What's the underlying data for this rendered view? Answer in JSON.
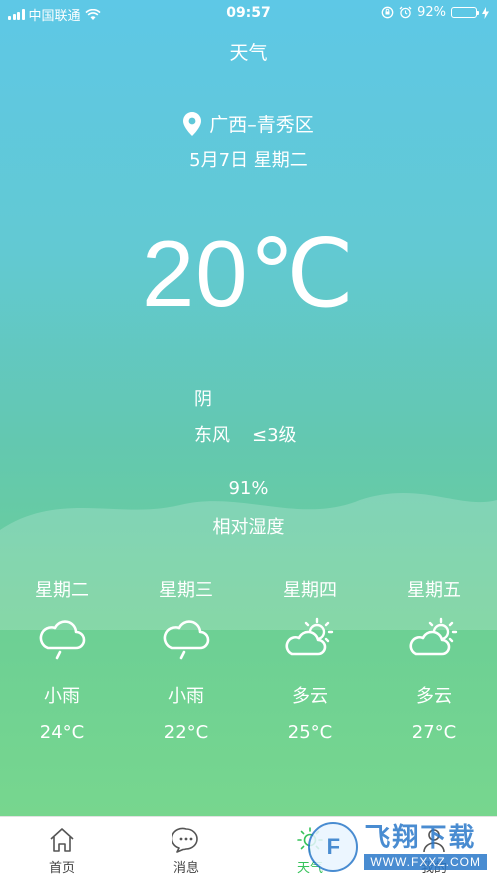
{
  "status_bar": {
    "carrier": "中国联通",
    "time": "09:57",
    "battery_pct": "92%",
    "battery_level": 0.92
  },
  "page": {
    "title": "天气"
  },
  "location": {
    "icon": "map-pin-icon",
    "text": "广西–青秀区"
  },
  "date": "5月7日  星期二",
  "current": {
    "temperature": "20℃",
    "condition": "阴",
    "wind_dir": "东风",
    "wind_level": "≤3级",
    "humidity_value": "91%",
    "humidity_label": "相对湿度"
  },
  "forecast": [
    {
      "day": "星期二",
      "icon": "rain-cloud-icon",
      "condition": "小雨",
      "temp": "24°C"
    },
    {
      "day": "星期三",
      "icon": "rain-cloud-icon",
      "condition": "小雨",
      "temp": "22°C"
    },
    {
      "day": "星期四",
      "icon": "partly-cloudy-icon",
      "condition": "多云",
      "temp": "25°C"
    },
    {
      "day": "星期五",
      "icon": "partly-cloudy-icon",
      "condition": "多云",
      "temp": "27°C"
    }
  ],
  "nav": {
    "tabs": [
      {
        "label": "首页",
        "icon": "home-icon"
      },
      {
        "label": "消息",
        "icon": "chat-icon"
      },
      {
        "label": "天气",
        "icon": "sun-icon",
        "active": true
      },
      {
        "label": "我的",
        "icon": "user-icon"
      }
    ],
    "active_color": "#36c25a"
  },
  "watermark": {
    "logo": "F",
    "main": "飞翔下载",
    "url": "WWW.FXXZ.COM"
  }
}
